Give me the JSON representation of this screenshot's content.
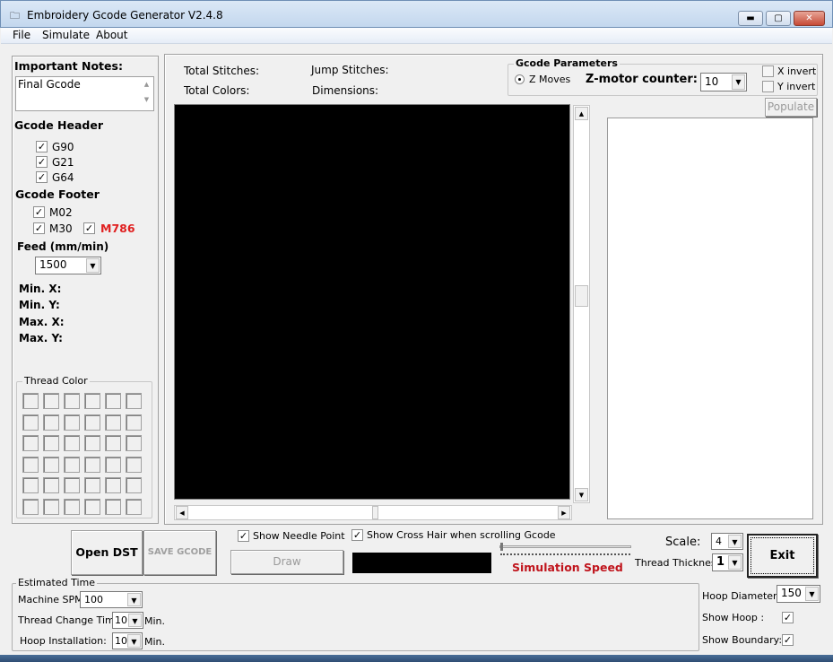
{
  "window": {
    "title": "Embroidery Gcode Generator V2.4.8",
    "minimize": "▬",
    "maximize": "▢",
    "close": "✕"
  },
  "menu": [
    "File",
    "Simulate",
    "About"
  ],
  "left": {
    "notes_label": "Important Notes:",
    "notes_value": "Final Gcode",
    "header_label": "Gcode Header",
    "header_items": [
      {
        "label": "G90",
        "checked": true
      },
      {
        "label": "G21",
        "checked": true
      },
      {
        "label": "G64",
        "checked": true
      }
    ],
    "footer_label": "Gcode Footer",
    "footer_items": [
      {
        "label": "M02",
        "checked": true
      },
      {
        "label": "M30",
        "checked": true
      },
      {
        "label": "M786",
        "checked": true,
        "color": "#e02020"
      }
    ],
    "feed_label": "Feed (mm/min)",
    "feed_value": "1500",
    "min_x": "Min. X:",
    "min_y": "Min. Y:",
    "max_x": "Max. X:",
    "max_y": "Max. Y:",
    "thread_color_label": "Thread Color"
  },
  "stats": {
    "total_stitches": "Total Stitches:",
    "jump_stitches": "Jump Stitches:",
    "total_colors": "Total Colors:",
    "dimensions": "Dimensions:"
  },
  "gcode_params": {
    "title": "Gcode Parameters",
    "z_moves": "Z Moves",
    "z_moves_selected": true,
    "z_counter_label": "Z-motor counter:",
    "z_counter_value": "10",
    "x_invert": "X invert",
    "y_invert": "Y invert"
  },
  "populate": "Populate",
  "bottom": {
    "open_dst": "Open DST",
    "save_gcode": "SAVE GCODE",
    "draw": "Draw",
    "show_needle": "Show Needle Point",
    "show_crosshair": "Show Cross Hair when scrolling Gcode",
    "sim_speed": "Simulation Speed",
    "sim_speed_color": "#c0141c",
    "scale_label": "Scale:",
    "scale_value": "4",
    "thread_thickness_label": "Thread Thickness",
    "thread_thickness_value": "1",
    "exit": "Exit"
  },
  "estimated": {
    "title": "Estimated Time",
    "spm_label": "Machine SPM:",
    "spm_value": "100",
    "thread_change_label": "Thread Change Time:",
    "thread_change_value": "10",
    "hoop_install_label": "Hoop Installation:",
    "hoop_install_value": "10",
    "min": "Min."
  },
  "hoop": {
    "diameter_label": "Hoop Diameter:",
    "diameter_value": "150",
    "show_hoop": "Show Hoop :",
    "show_boundary": "Show Boundary:"
  }
}
